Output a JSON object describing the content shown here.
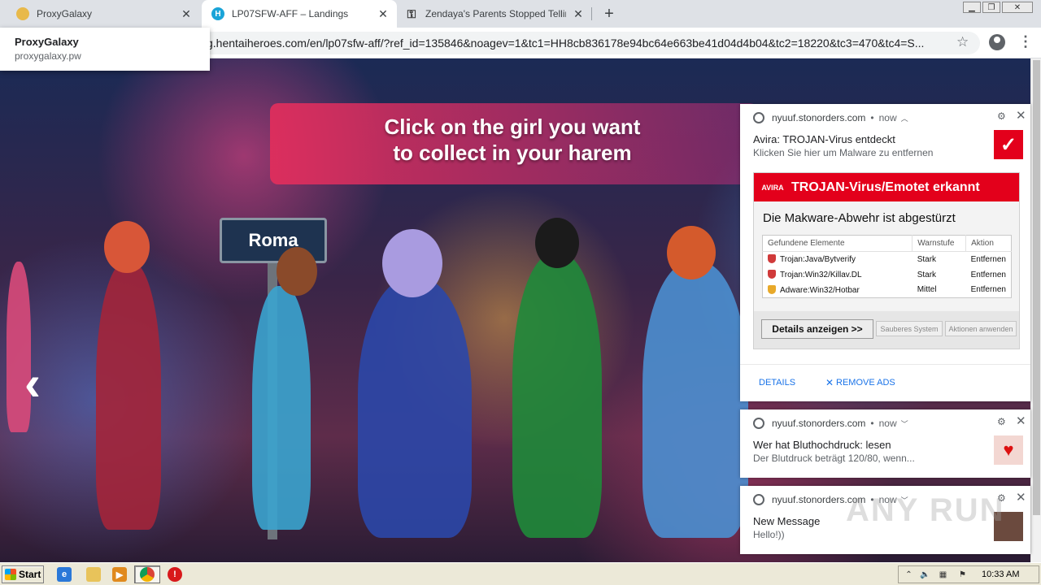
{
  "tabs": [
    {
      "title": "ProxyGalaxy",
      "icon": "globe-icon",
      "active": false
    },
    {
      "title": "LP07SFW-AFF – Landings",
      "icon": "hentaiheroes-icon",
      "active": true
    },
    {
      "title": "Zendaya's Parents Stopped Telling H",
      "icon": "key-icon",
      "active": false
    }
  ],
  "tooltip": {
    "title": "ProxyGalaxy",
    "subtitle": "proxygalaxy.pw"
  },
  "address_bar": {
    "url": "g.hentaiheroes.com/en/lp07sfw-aff/?ref_id=135846&noagev=1&tc1=HH8cb836178e94bc64e663be41d04d4b04&tc2=18220&tc3=470&tc4=S..."
  },
  "page": {
    "banner_line1": "Click on the girl you want",
    "banner_line2": "to collect in your harem",
    "sign": "Roma",
    "prev_arrow": "‹"
  },
  "notifications": [
    {
      "source": "nyuuf.stonorders.com",
      "time": "now",
      "title": "Avira: TROJAN-Virus entdeckt",
      "body": "Klicken Sie hier um Malware zu entfernen",
      "image": {
        "header_logo": "AVIRA",
        "header": "TROJAN-Virus/Emotet erkannt",
        "subheader": "Die Makware-Abwehr ist abgestürzt",
        "columns": [
          "Gefundene Elemente",
          "Warnstufe",
          "Aktion"
        ],
        "rows": [
          [
            "Trojan:Java/Bytverify",
            "Stark",
            "Entfernen"
          ],
          [
            "Trojan:Win32/Killav.DL",
            "Stark",
            "Entfernen"
          ],
          [
            "Adware:Win32/Hotbar",
            "Mittel",
            "Entfernen"
          ]
        ],
        "button_main": "Details anzeigen >>",
        "button_2": "Sauberes System",
        "button_3": "Aktionen anwenden"
      },
      "actions": [
        "DETAILS",
        "REMOVE ADS"
      ]
    },
    {
      "source": "nyuuf.stonorders.com",
      "time": "now",
      "title": "Wer hat Bluthochdruck: lesen",
      "body": "Der Blutdruck beträgt 120/80, wenn..."
    },
    {
      "source": "nyuuf.stonorders.com",
      "time": "now",
      "title": "New Message",
      "body": "Hello!))"
    }
  ],
  "taskbar": {
    "start_label": "Start",
    "clock": "10:33 AM"
  },
  "watermark": "ANY RUN",
  "colors": {
    "avira_red": "#e3001b",
    "banner_pink": "#e22e5c",
    "link_blue": "#1a73e8"
  }
}
